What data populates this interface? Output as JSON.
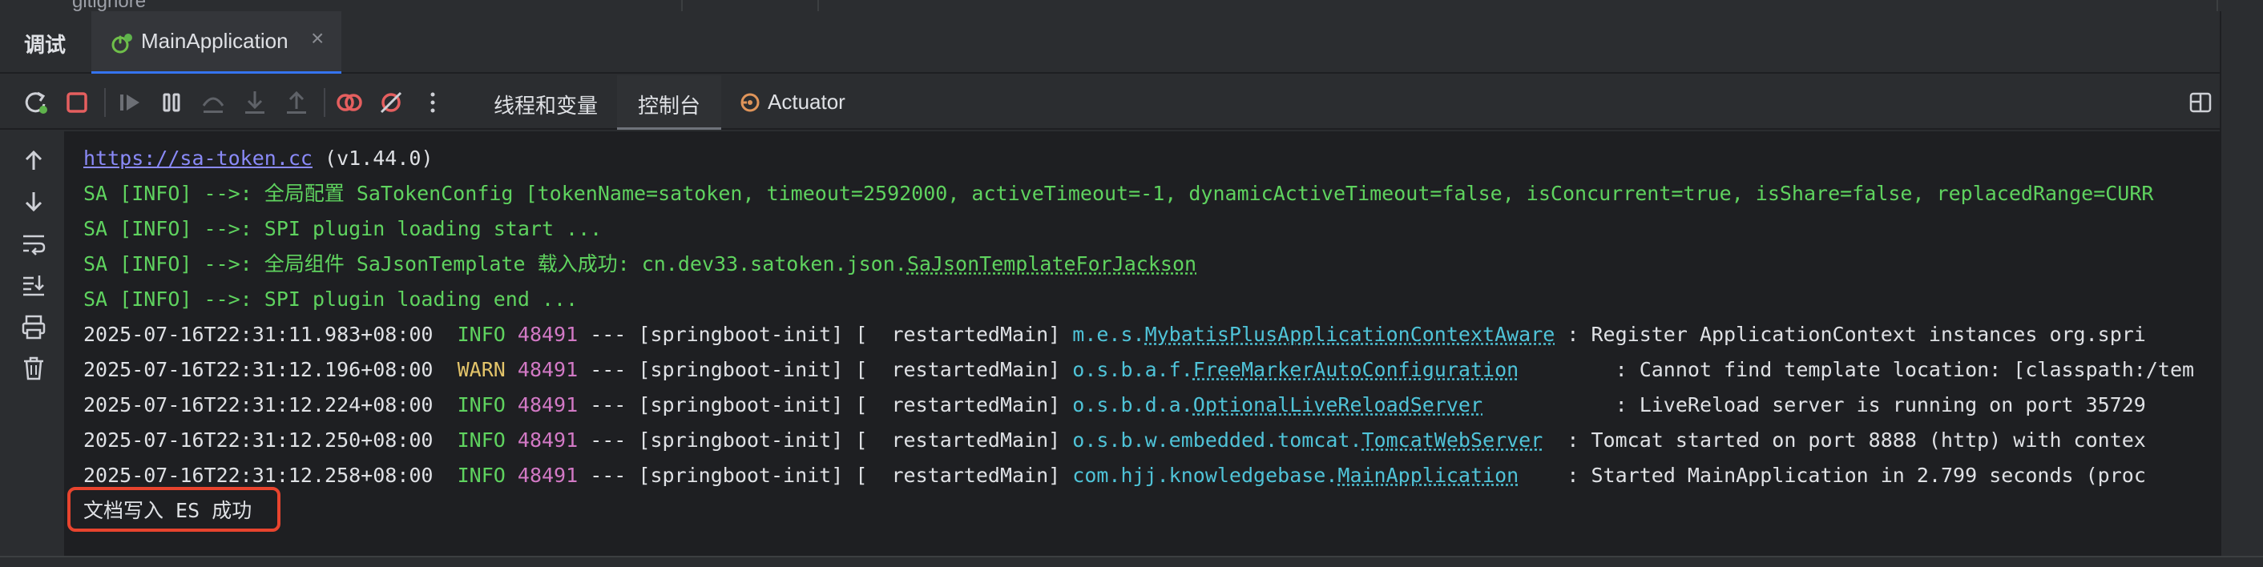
{
  "file_tree": {
    "visible_fragment": "gitignore"
  },
  "panel": {
    "title": "调试"
  },
  "run_tab": {
    "label": "MainApplication",
    "close": "×",
    "icon": "spring-boot-run-icon"
  },
  "toolbar": {
    "icons": [
      "rerun-icon",
      "stop-icon",
      "resume-icon",
      "pause-icon",
      "step-over-icon",
      "step-into-icon",
      "step-out-icon",
      "view-breakpoints-icon",
      "mute-breakpoints-icon",
      "more-icon"
    ],
    "tabs": [
      {
        "label": "线程和变量"
      },
      {
        "label": "控制台"
      },
      {
        "label": "Actuator"
      }
    ],
    "active_tab": "控制台"
  },
  "gutter": {
    "icons": [
      "scroll-up-icon",
      "scroll-down-icon",
      "soft-wrap-icon",
      "scroll-to-end-icon",
      "print-icon",
      "clear-all-icon"
    ]
  },
  "console": {
    "lines": [
      {
        "link": "https://sa-token.cc",
        "rest": " (v1.44.0)"
      },
      {
        "text": "SA [INFO] -->: 全局配置 SaTokenConfig [tokenName=satoken, timeout=2592000, activeTimeout=-1, dynamicActiveTimeout=false, isConcurrent=true, isShare=false, replacedRange=CURR"
      },
      {
        "text": "SA [INFO] -->: SPI plugin loading start ..."
      },
      {
        "text_prefix": "SA [INFO] -->: 全局组件 SaJsonTemplate 载入成功: cn.dev33.satoken.json.",
        "text_link": "SaJsonTemplateForJackson"
      },
      {
        "text": "SA [INFO] -->: SPI plugin loading end ..."
      }
    ],
    "log_lines": [
      {
        "ts": "2025-07-16T22:31:11.983+08:00",
        "level": "INFO",
        "pid": "48491",
        "mid": " --- [springboot-init] [  restartedMain] ",
        "pkg": "m.e.s.",
        "cls": "MybatisPlusApplicationContextAware",
        "pad": " ",
        "msg": ": Register ApplicationContext instances org.spri"
      },
      {
        "ts": "2025-07-16T22:31:12.196+08:00",
        "level": "WARN",
        "pid": "48491",
        "mid": " --- [springboot-init] [  restartedMain] ",
        "pkg": "o.s.b.a.f.",
        "cls": "FreeMarkerAutoConfiguration",
        "pad": "        ",
        "msg": ": Cannot find template location: [classpath:/tem"
      },
      {
        "ts": "2025-07-16T22:31:12.224+08:00",
        "level": "INFO",
        "pid": "48491",
        "mid": " --- [springboot-init] [  restartedMain] ",
        "pkg": "o.s.b.d.a.",
        "cls": "OptionalLiveReloadServer",
        "pad": "           ",
        "msg": ": LiveReload server is running on port 35729"
      },
      {
        "ts": "2025-07-16T22:31:12.250+08:00",
        "level": "INFO",
        "pid": "48491",
        "mid": " --- [springboot-init] [  restartedMain] ",
        "pkg": "o.s.b.w.embedded.tomcat.",
        "cls": "TomcatWebServer",
        "pad": "  ",
        "msg": ": Tomcat started on port 8888 (http) with contex"
      },
      {
        "ts": "2025-07-16T22:31:12.258+08:00",
        "level": "INFO",
        "pid": "48491",
        "mid": " --- [springboot-init] [  restartedMain] ",
        "pkg": "com.hjj.knowledgebase.",
        "cls": "MainApplication",
        "pad": "    ",
        "msg": ": Started MainApplication in 2.799 seconds (proc"
      }
    ],
    "highlighted_line": "文档写入 ES 成功"
  },
  "colors": {
    "console_bg": "#1e1f22",
    "info_green": "#5fd35f",
    "warn_yellow": "#e3c46a",
    "pid_magenta": "#d279c5",
    "class_cyan": "#4fc3d8",
    "highlight_red": "#e8442e"
  }
}
